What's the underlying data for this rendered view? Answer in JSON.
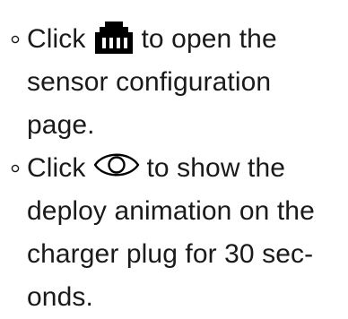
{
  "items": [
    {
      "icon": "ethernet-port-icon",
      "before": "Click",
      "after": "to open the",
      "line2": "sensor configuration",
      "line3": "page."
    },
    {
      "icon": "eye-icon",
      "before": "Click",
      "after": "to show the",
      "line2": "deploy animation on the",
      "line3": "charger plug for 30 sec-",
      "line4": "onds."
    }
  ]
}
